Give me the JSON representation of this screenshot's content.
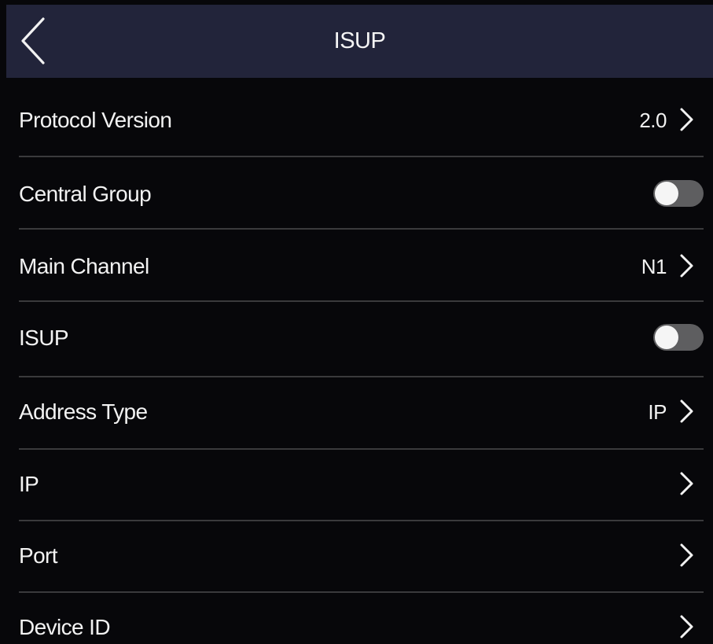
{
  "header": {
    "title": "ISUP",
    "back_icon": "chevron-left-icon"
  },
  "colors": {
    "background": "#07070a",
    "header_background": "#22243a",
    "divider": "#3a3a3c",
    "toggle_off_track": "#5e5e60",
    "toggle_knob": "#f5f5f5",
    "text": "#f2f2f2"
  },
  "settings": {
    "protocol_version": {
      "label": "Protocol Version",
      "value": "2.0"
    },
    "central_group": {
      "label": "Central Group",
      "enabled": false
    },
    "main_channel": {
      "label": "Main Channel",
      "value": "N1"
    },
    "isup": {
      "label": "ISUP",
      "enabled": false
    },
    "address_type": {
      "label": "Address Type",
      "value": "IP"
    },
    "ip": {
      "label": "IP",
      "value": ""
    },
    "port": {
      "label": "Port",
      "value": ""
    },
    "device_id": {
      "label": "Device ID",
      "value": ""
    }
  }
}
